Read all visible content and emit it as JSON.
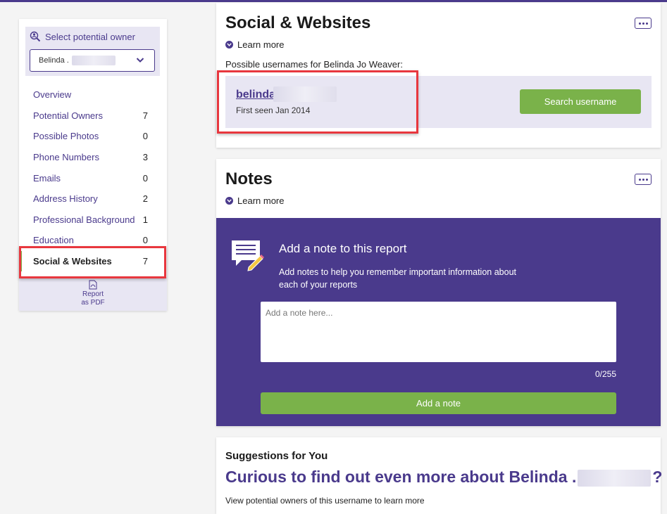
{
  "sidebar": {
    "owner_label": "Select potential owner",
    "owner_selected": "Belinda .",
    "nav": [
      {
        "label": "Overview",
        "count": ""
      },
      {
        "label": "Potential Owners",
        "count": "7"
      },
      {
        "label": "Possible Photos",
        "count": "0"
      },
      {
        "label": "Phone Numbers",
        "count": "3"
      },
      {
        "label": "Emails",
        "count": "0"
      },
      {
        "label": "Address History",
        "count": "2"
      },
      {
        "label": "Professional Background",
        "count": "1"
      },
      {
        "label": "Education",
        "count": "0"
      },
      {
        "label": "Social & Websites",
        "count": "7"
      }
    ],
    "pdf_line1": "Report",
    "pdf_line2": "as PDF"
  },
  "social": {
    "title": "Social & Websites",
    "learn_more": "Learn more",
    "possible_text": "Possible usernames for Belinda Jo Weaver:",
    "username": "belinda",
    "first_seen": "First seen Jan 2014",
    "search_button": "Search username"
  },
  "notes": {
    "title": "Notes",
    "learn_more": "Learn more",
    "panel_title": "Add a note to this report",
    "panel_desc": "Add notes to help you remember important information about each of your reports",
    "placeholder": "Add a note here...",
    "counter": "0/255",
    "add_button": "Add a note"
  },
  "suggestions": {
    "title": "Suggestions for You",
    "headline_start": "Curious to find out even more about Belinda .",
    "headline_end": "?",
    "subtext": "View potential owners of this username to learn more"
  },
  "colors": {
    "brand": "#4a3a8c",
    "accent": "#7ab24a",
    "highlight": "#e8373e"
  }
}
